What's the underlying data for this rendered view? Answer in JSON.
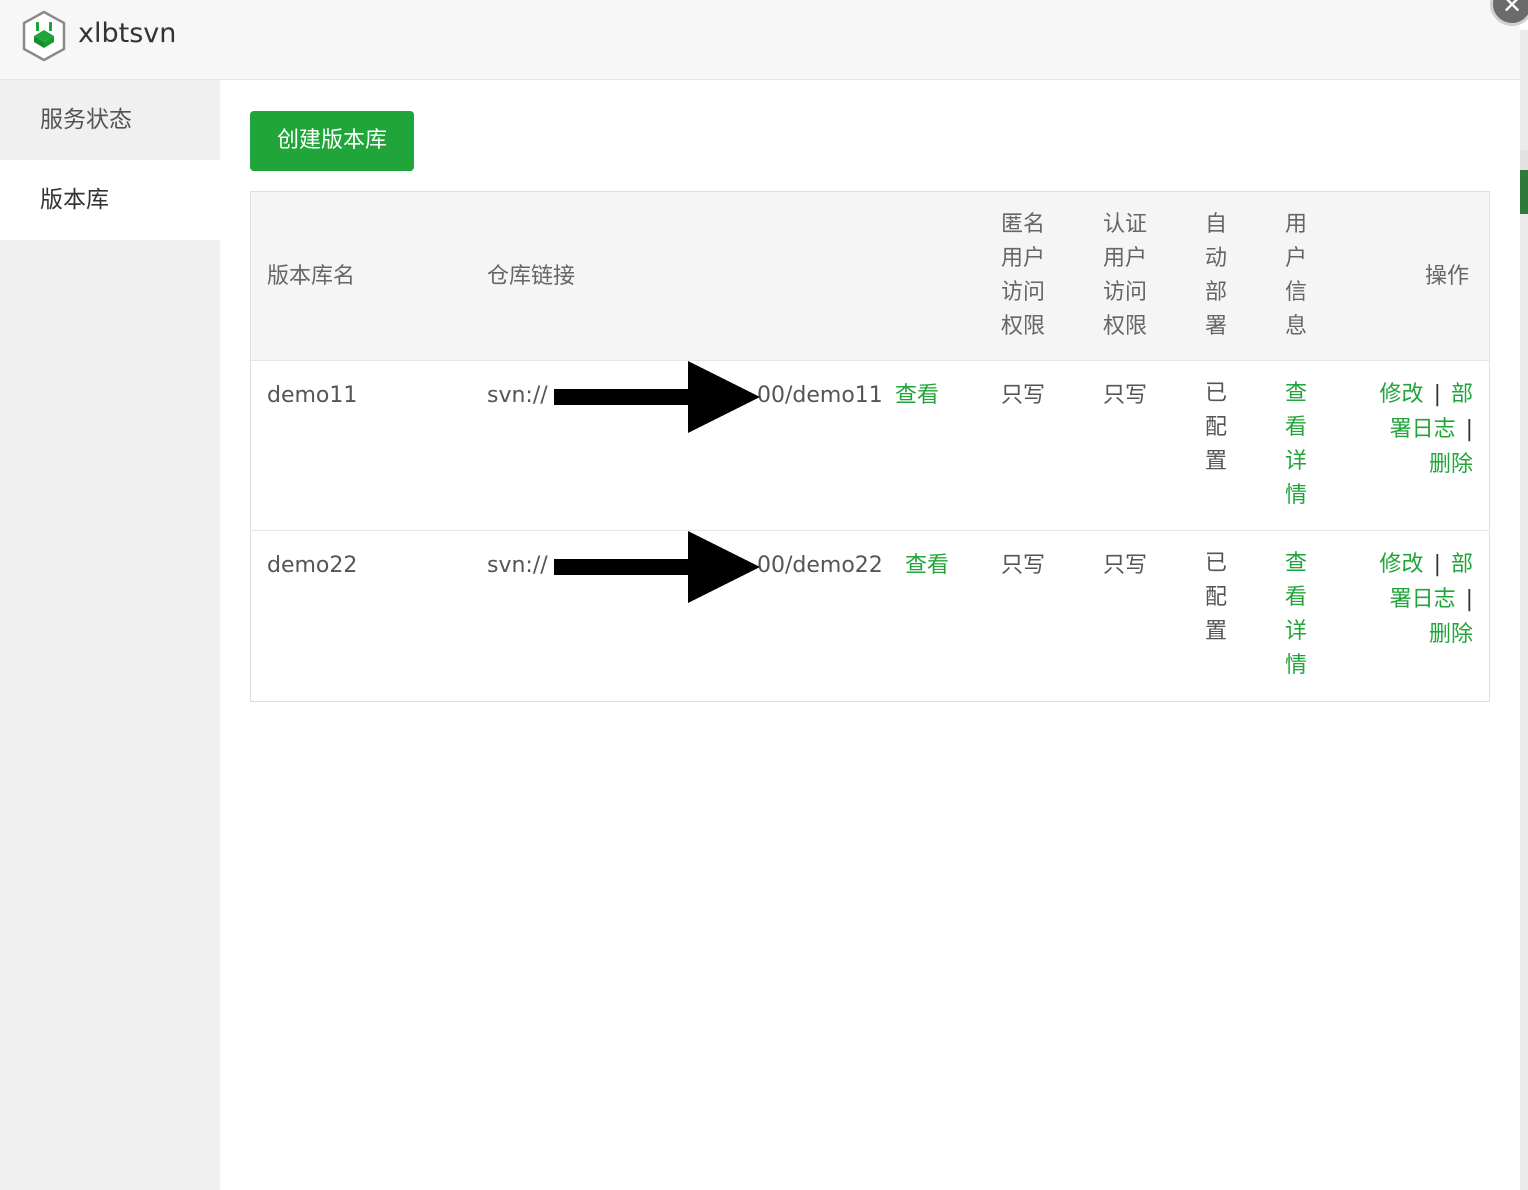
{
  "app": {
    "title": "xlbtsvn",
    "close_glyph": "✕"
  },
  "sidebar": {
    "items": [
      {
        "label": "服务状态",
        "active": false
      },
      {
        "label": "版本库",
        "active": true
      }
    ]
  },
  "toolbar": {
    "create_label": "创建版本库"
  },
  "table": {
    "headers": {
      "name": "版本库名",
      "link": "仓库链接",
      "anon": "匿名用户访问权限",
      "auth": "认证用户访问权限",
      "deploy": "自动部署",
      "userinfo": "用户信息",
      "ops": "操作"
    },
    "rows": [
      {
        "name": "demo11",
        "link_prefix": "svn://",
        "link_suffix": "00/demo11",
        "view": "查看",
        "anon": "只写",
        "auth": "只写",
        "deploy": "已配置",
        "userinfo": "查看详情",
        "op_edit": "修改",
        "op_deploy_log_a": "部",
        "op_deploy_log_b": "署日志",
        "op_delete": "删除",
        "sep": "|"
      },
      {
        "name": "demo22",
        "link_prefix": "svn://",
        "link_suffix": "00/demo22",
        "view": "查看",
        "anon": "只写",
        "auth": "只写",
        "deploy": "已配置",
        "userinfo": "查看详情",
        "op_edit": "修改",
        "op_deploy_log_a": "部",
        "op_deploy_log_b": "署日志",
        "op_delete": "删除",
        "sep": "|"
      }
    ]
  },
  "colors": {
    "accent": "#20a53a",
    "sidebar_bg": "#f0f0f0",
    "header_bg": "#f7f7f7"
  },
  "icons": {
    "logo": "xlbtsvn-logo-icon",
    "close": "close-icon",
    "arrow": "arrow-right-icon"
  }
}
